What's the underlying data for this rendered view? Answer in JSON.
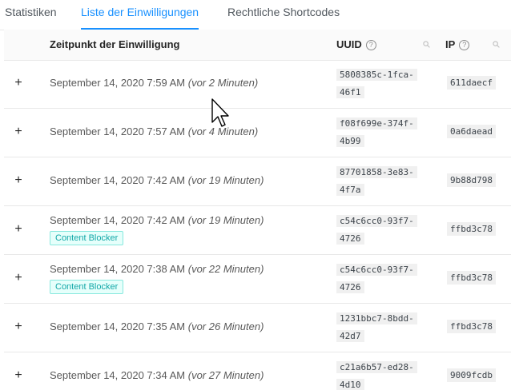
{
  "tabs": [
    {
      "label": "Statistiken"
    },
    {
      "label": "Liste der Einwilligungen"
    },
    {
      "label": "Rechtliche Shortcodes"
    }
  ],
  "columns": {
    "time": "Zeitpunkt der Einwilligung",
    "uuid": "UUID",
    "ip": "IP",
    "help_glyph": "?"
  },
  "rows": [
    {
      "date": "September 14, 2020 7:59 AM",
      "rel": "(vor 2 Minuten)",
      "uuid1": "5808385c-1fca-",
      "uuid2": "46f1",
      "ip": "611daecf",
      "tag": ""
    },
    {
      "date": "September 14, 2020 7:57 AM",
      "rel": "(vor 4 Minuten)",
      "uuid1": "f08f699e-374f-",
      "uuid2": "4b99",
      "ip": "0a6daead",
      "tag": ""
    },
    {
      "date": "September 14, 2020 7:42 AM",
      "rel": "(vor 19 Minuten)",
      "uuid1": "87701858-3e83-",
      "uuid2": "4f7a",
      "ip": "9b88d798",
      "tag": ""
    },
    {
      "date": "September 14, 2020 7:42 AM",
      "rel": "(vor 19 Minuten)",
      "uuid1": "c54c6cc0-93f7-",
      "uuid2": "4726",
      "ip": "ffbd3c78",
      "tag": "Content Blocker"
    },
    {
      "date": "September 14, 2020 7:38 AM",
      "rel": "(vor 22 Minuten)",
      "uuid1": "c54c6cc0-93f7-",
      "uuid2": "4726",
      "ip": "ffbd3c78",
      "tag": "Content Blocker"
    },
    {
      "date": "September 14, 2020 7:35 AM",
      "rel": "(vor 26 Minuten)",
      "uuid1": "1231bbc7-8bdd-",
      "uuid2": "42d7",
      "ip": "ffbd3c78",
      "tag": ""
    },
    {
      "date": "September 14, 2020 7:34 AM",
      "rel": "(vor 27 Minuten)",
      "uuid1": "c21a6b57-ed28-",
      "uuid2": "4d10",
      "ip": "9009fcdb",
      "tag": ""
    }
  ],
  "expand_glyph": "+",
  "colors": {
    "accent": "#1890ff",
    "tag": "#13a8a8"
  }
}
